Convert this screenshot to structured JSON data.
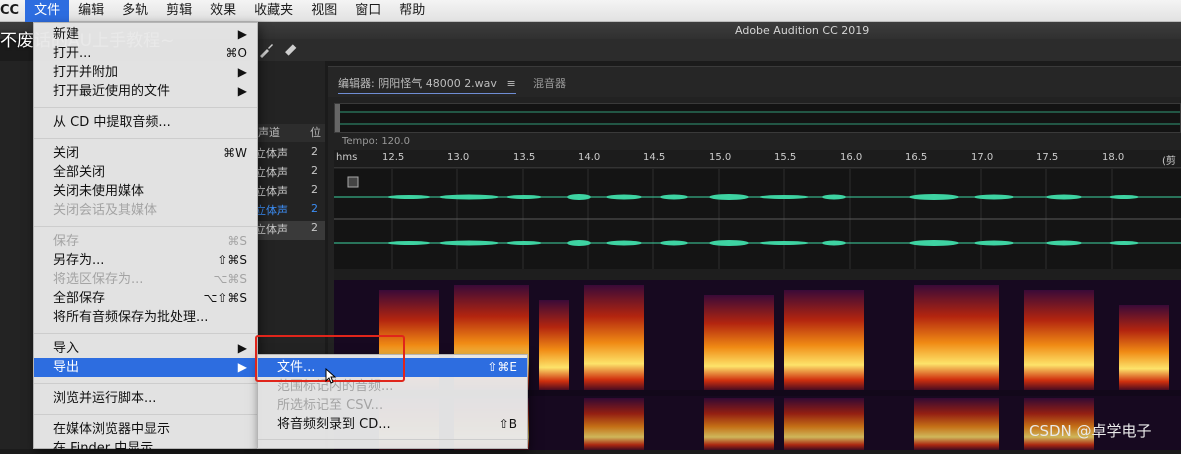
{
  "menubar": {
    "app": "CC",
    "items": [
      "文件",
      "编辑",
      "多轨",
      "剪辑",
      "效果",
      "收藏夹",
      "视图",
      "窗口",
      "帮助"
    ]
  },
  "window_title": "Adobe Audition CC 2019",
  "overlay_text": "不废话的AU上手教程~",
  "left_panel": {
    "col_header": "声道",
    "col_header2": "位",
    "rows": [
      "立体声",
      "立体声",
      "立体声",
      "立体声",
      "立体声"
    ],
    "row_suffix": "2"
  },
  "editor": {
    "tab_editor": "编辑器: 阴阳怪气 48000 2.wav",
    "tab_menu_icon": "≡",
    "tab_mixer": "混音器",
    "tempo": "Tempo: 120.0",
    "ruler_start": "hms",
    "ruler_ticks": [
      "12.5",
      "13.0",
      "13.5",
      "14.0",
      "14.5",
      "15.0",
      "15.5",
      "16.0",
      "16.5",
      "17.0",
      "17.5",
      "18.0"
    ],
    "ruler_end": "(剪"
  },
  "file_menu": {
    "items": [
      {
        "label": "新建",
        "shortcut": "",
        "arrow": true,
        "disabled": false
      },
      {
        "label": "打开...",
        "shortcut": "⌘O",
        "arrow": false,
        "disabled": false
      },
      {
        "label": "打开并附加",
        "shortcut": "",
        "arrow": true,
        "disabled": false
      },
      {
        "label": "打开最近使用的文件",
        "shortcut": "",
        "arrow": true,
        "disabled": false
      },
      {
        "label": "从 CD 中提取音频...",
        "shortcut": "",
        "arrow": false,
        "disabled": false
      },
      {
        "label": "关闭",
        "shortcut": "⌘W",
        "arrow": false,
        "disabled": false
      },
      {
        "label": "全部关闭",
        "shortcut": "",
        "arrow": false,
        "disabled": false
      },
      {
        "label": "关闭未使用媒体",
        "shortcut": "",
        "arrow": false,
        "disabled": false
      },
      {
        "label": "关闭会话及其媒体",
        "shortcut": "",
        "arrow": false,
        "disabled": true
      },
      {
        "label": "保存",
        "shortcut": "⌘S",
        "arrow": false,
        "disabled": true
      },
      {
        "label": "另存为...",
        "shortcut": "⇧⌘S",
        "arrow": false,
        "disabled": false
      },
      {
        "label": "将选区保存为...",
        "shortcut": "⌥⌘S",
        "arrow": false,
        "disabled": true
      },
      {
        "label": "全部保存",
        "shortcut": "⌥⇧⌘S",
        "arrow": false,
        "disabled": false
      },
      {
        "label": "将所有音频保存为批处理...",
        "shortcut": "",
        "arrow": false,
        "disabled": false
      },
      {
        "label": "导入",
        "shortcut": "",
        "arrow": true,
        "disabled": false
      },
      {
        "label": "导出",
        "shortcut": "",
        "arrow": true,
        "disabled": false
      },
      {
        "label": "浏览并运行脚本...",
        "shortcut": "",
        "arrow": false,
        "disabled": false
      },
      {
        "label": "在媒体浏览器中显示",
        "shortcut": "",
        "arrow": false,
        "disabled": false
      },
      {
        "label": "在 Finder 中显示",
        "shortcut": "",
        "arrow": false,
        "disabled": false
      }
    ]
  },
  "export_submenu": {
    "items": [
      {
        "label": "文件...",
        "shortcut": "⇧⌘E",
        "disabled": false
      },
      {
        "label": "范围标记内的音频...",
        "shortcut": "",
        "disabled": true
      },
      {
        "label": "所选标记至 CSV...",
        "shortcut": "",
        "disabled": true
      },
      {
        "label": "将音频刻录到 CD...",
        "shortcut": "⇧B",
        "disabled": false
      }
    ]
  },
  "watermark": "CSDN @卓学电子",
  "colors": {
    "menu_highlight": "#2d6de0",
    "waveform": "#3ed3a2",
    "annotation_box": "#e0251b"
  }
}
